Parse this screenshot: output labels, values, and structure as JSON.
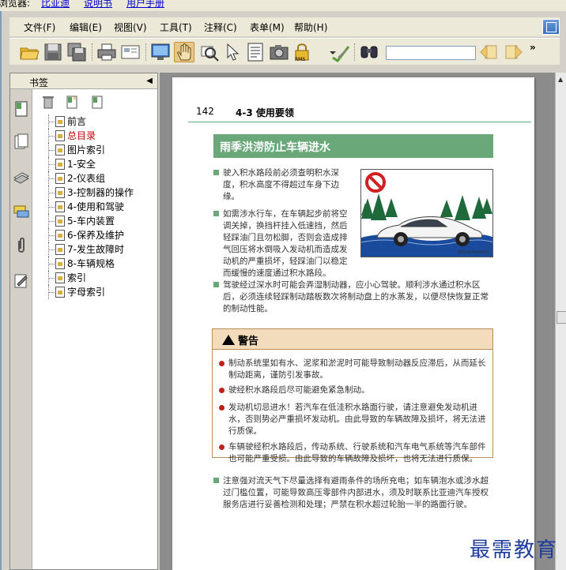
{
  "top_strip": {
    "cut_text": "浏览器:",
    "links": [
      "比亚迪",
      "说明书",
      "用户手册"
    ]
  },
  "menubar": {
    "items": [
      "文件(F)",
      "编辑(E)",
      "视图(V)",
      "工具(T)",
      "注释(C)",
      "表单(M)",
      "帮助(H)"
    ]
  },
  "toolbar": {
    "icons": [
      "open-folder-icon",
      "save-icon",
      "save-all-icon",
      "print-icon",
      "email-icon",
      "fullscreen-icon",
      "hand-tool-icon",
      "zoom-tool-icon",
      "select-arrow-icon",
      "text-select-icon",
      "snapshot-icon",
      "rms-lock-icon",
      "sign-icon",
      "find-icon",
      "find-prev-icon",
      "find-next-icon"
    ],
    "lock_label": "RMS",
    "find_value": "",
    "more": "»"
  },
  "bookmarks": {
    "title": "书签",
    "items": [
      {
        "label": "前言",
        "active": false
      },
      {
        "label": "总目录",
        "active": true
      },
      {
        "label": "图片索引",
        "active": false
      },
      {
        "label": "1-安全",
        "active": false
      },
      {
        "label": "2-仪表组",
        "active": false
      },
      {
        "label": "3-控制器的操作",
        "active": false
      },
      {
        "label": "4-使用和驾驶",
        "active": false
      },
      {
        "label": "5-车内装置",
        "active": false
      },
      {
        "label": "6-保养及维护",
        "active": false
      },
      {
        "label": "7-发生故障时",
        "active": false
      },
      {
        "label": "8-车辆规格",
        "active": false
      },
      {
        "label": "索引",
        "active": false
      },
      {
        "label": "字母索引",
        "active": false
      }
    ]
  },
  "page": {
    "page_number": "142",
    "section_title": "4-3 使用要领",
    "banner": "雨季洪涝防止车辆进水",
    "paragraphs": [
      "驶入积水路段前必须查明积水深度，积水高度不得超过车身下边缘。",
      "如需涉水行车，在车辆起步前将空调关掉，换挡杆挂入低速挡，然后轻踩油门且勿松脚，否则会造成排气回压将水倒吸入发动机而造成发动机的严重损坏，轻踩油门以稳定而缓慢的速度通过积水路段。",
      "驾驶经过深水时可能会弄湿制动器，应小心驾驶。顺利涉水通过积水区后，必须连续轻踩制动踏板数次将制动盘上的水蒸发，以便尽快恢复正常的制动性能。"
    ],
    "illustration_code": "BYDHA2H04025",
    "warning_title": "警告",
    "warnings": [
      "制动系统里如有水、泥浆和淤泥时可能导致制动器反应滞后，从而延长制动距离，谨防引发事故。",
      "驶经积水路段后尽可能避免紧急制动。",
      "发动机切忌进水！若汽车在低洼积水路面行驶，请注意避免发动机进水，否则势必严重损坏发动机。由此导致的车辆故障及损坏，将无法进行质保。",
      "车辆驶经积水路段后，传动系统、行驶系统和汽车电气系统等汽车部件也可能严重受损。由此导致的车辆故障及损坏，也将无法进行质保。"
    ],
    "footer_paragraph": "注意强对流天气下尽量选择有避雨条件的场所充电；如车辆泡水或涉水超过门槛位置，可能导致高压零部件内部进水，须及时联系比亚迪汽车授权服务店进行妥善检测和处理；严禁在积水超过轮胎一半的路面行驶。"
  },
  "watermark": "最需教育"
}
